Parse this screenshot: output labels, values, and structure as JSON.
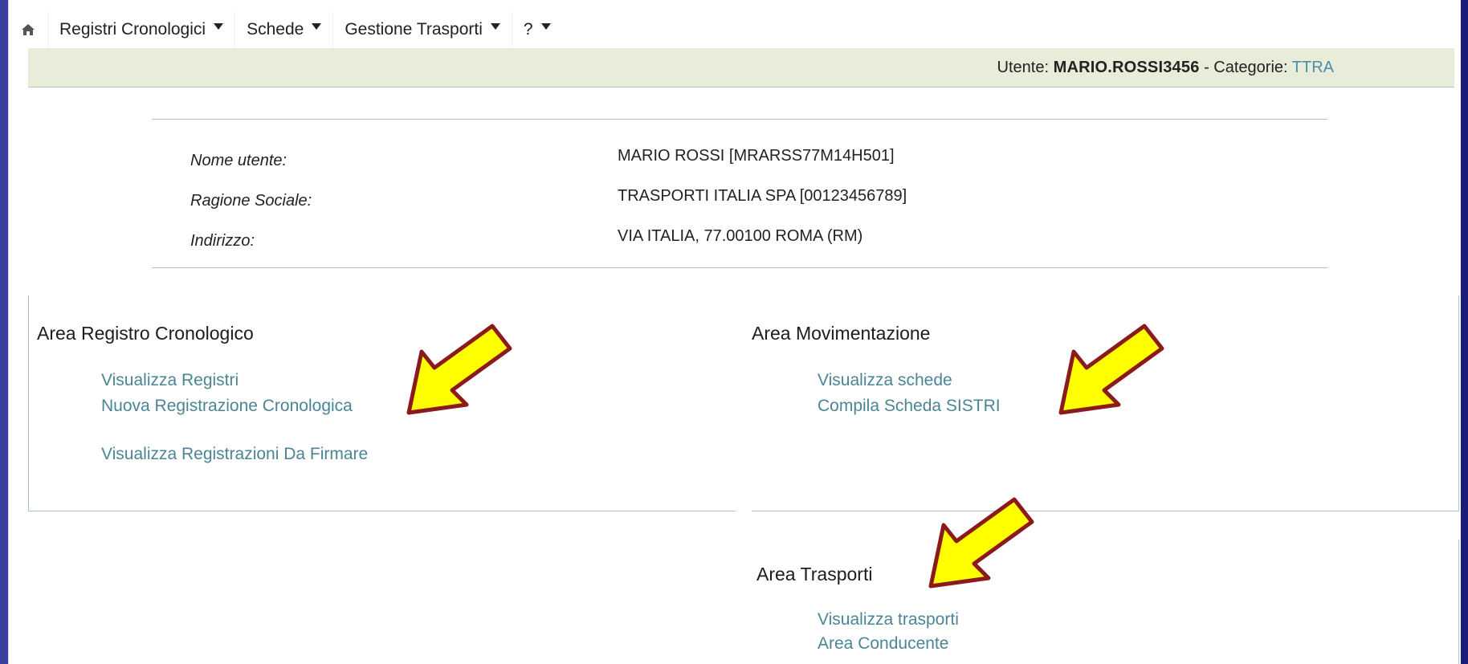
{
  "menu": {
    "home_icon": "home-icon",
    "items": [
      {
        "label": "Registri Cronologici"
      },
      {
        "label": "Schede"
      },
      {
        "label": "Gestione Trasporti"
      },
      {
        "label": "?"
      }
    ]
  },
  "userbar": {
    "user_prefix": "Utente: ",
    "username": "MARIO.ROSSI3456",
    "separator": " - Categorie: ",
    "category": "TTRA"
  },
  "info": {
    "rows": [
      {
        "label": "Nome utente:",
        "value": "MARIO ROSSI [MRARSS77M14H501]"
      },
      {
        "label": "Ragione Sociale:",
        "value": "TRASPORTI ITALIA SPA [00123456789]"
      },
      {
        "label": "Indirizzo:",
        "value": "VIA ITALIA, 77.00100 ROMA (RM)"
      }
    ]
  },
  "areas": {
    "registro": {
      "title": "Area Registro Cronologico",
      "links": [
        "Visualizza Registri",
        "Nuova Registrazione Cronologica",
        "Visualizza Registrazioni Da Firmare"
      ]
    },
    "movimentazione": {
      "title": "Area Movimentazione",
      "links": [
        "Visualizza schede",
        "Compila Scheda SISTRI"
      ]
    },
    "trasporti": {
      "title": "Area Trasporti",
      "links": [
        "Visualizza trasporti",
        "Area Conducente"
      ]
    }
  },
  "colors": {
    "background": "#23278a",
    "userbar": "#e7edd9",
    "link": "#4b8595",
    "category": "#4c8ea6",
    "arrow_fill": "#ffff00",
    "arrow_border": "#8b1a1a"
  }
}
